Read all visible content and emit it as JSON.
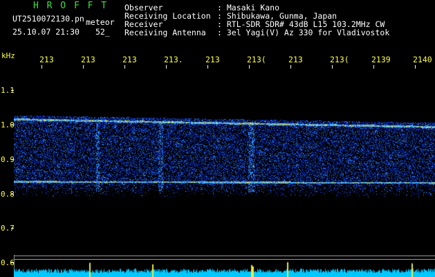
{
  "header": {
    "logo": "H R O F F T",
    "filename": "UT2510072130.pn",
    "mode_label": "meteor",
    "datetime": "25.10.07 21:30",
    "minute_marker": "52_",
    "fields": [
      {
        "label": "Observer",
        "value": ": Masaki Kano"
      },
      {
        "label": "Receiving Location",
        "value": ": Shibukawa, Gunma, Japan"
      },
      {
        "label": "Receiver",
        "value": ": RTL-SDR SDR# 43dB L15 103.2MHz CW"
      },
      {
        "label": "Receiving Antenna",
        "value": ": 3el Yagi(V) Az 330 for Vladivostok"
      }
    ]
  },
  "axis": {
    "unit": "kHz",
    "x_ticks": [
      "213",
      "213",
      "213",
      "213.",
      "213",
      "213(",
      "213",
      "213(",
      "2139",
      "2140"
    ],
    "y_ticks": [
      "1.1",
      "1.0",
      "0.9",
      "0.8",
      "0.7",
      "0.6"
    ]
  },
  "colors": {
    "background": "#000000",
    "header_text": "#ffffff",
    "axis_text": "#ffff40",
    "logo": "#40e040",
    "spectrum_base": "#0a0a8c",
    "bottom_trace": "#00c8ff"
  }
}
